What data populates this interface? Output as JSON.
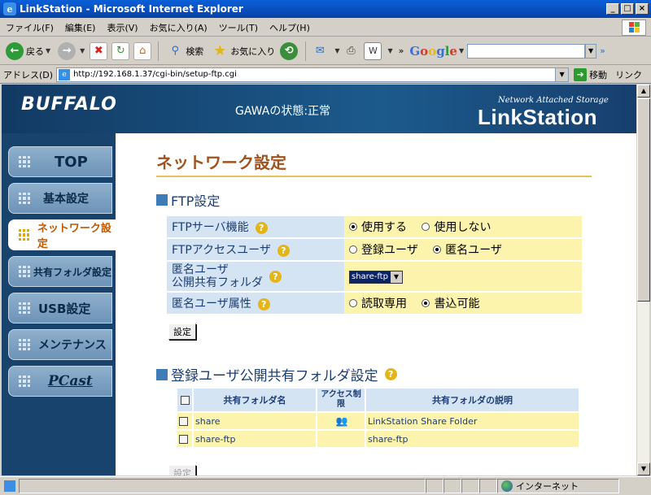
{
  "window": {
    "title": "LinkStation - Microsoft Internet Explorer"
  },
  "menu": [
    "ファイル(F)",
    "編集(E)",
    "表示(V)",
    "お気に入り(A)",
    "ツール(T)",
    "ヘルプ(H)"
  ],
  "toolbar": {
    "back": "戻る",
    "search": "検索",
    "favorites": "お気に入り",
    "google": "Google",
    "google_query": ""
  },
  "address": {
    "label": "アドレス(D)",
    "url": "http://192.168.1.37/cgi-bin/setup-ftp.cgi",
    "go": "移動",
    "links": "リンク"
  },
  "header": {
    "logo": "BUFFALO",
    "status": "GAWAの状態:正常",
    "nas_tagline": "Network Attached Storage",
    "product": "LinkStation"
  },
  "sidebar": {
    "items": [
      {
        "label": "TOP"
      },
      {
        "label": "基本設定"
      },
      {
        "label": "ネットワーク設定"
      },
      {
        "label": "共有フォルダ設定"
      },
      {
        "label": "USB設定"
      },
      {
        "label": "メンテナンス"
      },
      {
        "label": "PCast"
      }
    ]
  },
  "main": {
    "page_title": "ネットワーク設定",
    "ftp": {
      "title": "FTP設定",
      "server_label": "FTPサーバ機能",
      "server_on": "使用する",
      "server_off": "使用しない",
      "access_label": "FTPアクセスユーザ",
      "access_reg": "登録ユーザ",
      "access_anon": "匿名ユーザ",
      "anon_folder_label1": "匿名ユーザ",
      "anon_folder_label2": "公開共有フォルダ",
      "anon_folder_value": "share-ftp",
      "attr_label": "匿名ユーザ属性",
      "attr_ro": "読取専用",
      "attr_rw": "書込可能",
      "apply": "設定"
    },
    "shares": {
      "title": "登録ユーザ公開共有フォルダ設定",
      "col_name": "共有フォルダ名",
      "col_access": "アクセス制限",
      "col_desc": "共有フォルダの説明",
      "rows": [
        {
          "name": "share",
          "desc": "LinkStation Share Folder"
        },
        {
          "name": "share-ftp",
          "desc": "share-ftp"
        }
      ],
      "apply": "設定"
    }
  },
  "statusbar": {
    "zone": "インターネット"
  }
}
